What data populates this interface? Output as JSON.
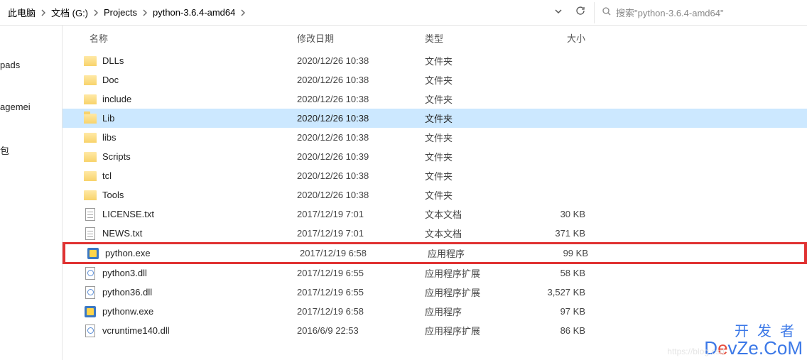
{
  "breadcrumb": [
    "此电脑",
    "文档 (G:)",
    "Projects",
    "python-3.6.4-amd64"
  ],
  "search": {
    "placeholder": "搜索\"python-3.6.4-amd64\""
  },
  "sidebar": {
    "items": [
      "pads",
      "agemei",
      "包"
    ]
  },
  "columns": {
    "name": "名称",
    "date": "修改日期",
    "type": "类型",
    "size": "大小"
  },
  "files": [
    {
      "name": "DLLs",
      "date": "2020/12/26 10:38",
      "type": "文件夹",
      "size": "",
      "icon": "folder"
    },
    {
      "name": "Doc",
      "date": "2020/12/26 10:38",
      "type": "文件夹",
      "size": "",
      "icon": "folder"
    },
    {
      "name": "include",
      "date": "2020/12/26 10:38",
      "type": "文件夹",
      "size": "",
      "icon": "folder"
    },
    {
      "name": "Lib",
      "date": "2020/12/26 10:38",
      "type": "文件夹",
      "size": "",
      "icon": "folder-open",
      "selected": true
    },
    {
      "name": "libs",
      "date": "2020/12/26 10:38",
      "type": "文件夹",
      "size": "",
      "icon": "folder"
    },
    {
      "name": "Scripts",
      "date": "2020/12/26 10:39",
      "type": "文件夹",
      "size": "",
      "icon": "folder"
    },
    {
      "name": "tcl",
      "date": "2020/12/26 10:38",
      "type": "文件夹",
      "size": "",
      "icon": "folder"
    },
    {
      "name": "Tools",
      "date": "2020/12/26 10:38",
      "type": "文件夹",
      "size": "",
      "icon": "folder"
    },
    {
      "name": "LICENSE.txt",
      "date": "2017/12/19 7:01",
      "type": "文本文档",
      "size": "30 KB",
      "icon": "txt"
    },
    {
      "name": "NEWS.txt",
      "date": "2017/12/19 7:01",
      "type": "文本文档",
      "size": "371 KB",
      "icon": "txt"
    },
    {
      "name": "python.exe",
      "date": "2017/12/19 6:58",
      "type": "应用程序",
      "size": "99 KB",
      "icon": "exe",
      "highlighted": true
    },
    {
      "name": "python3.dll",
      "date": "2017/12/19 6:55",
      "type": "应用程序扩展",
      "size": "58 KB",
      "icon": "dll"
    },
    {
      "name": "python36.dll",
      "date": "2017/12/19 6:55",
      "type": "应用程序扩展",
      "size": "3,527 KB",
      "icon": "dll"
    },
    {
      "name": "pythonw.exe",
      "date": "2017/12/19 6:58",
      "type": "应用程序",
      "size": "97 KB",
      "icon": "exe"
    },
    {
      "name": "vcruntime140.dll",
      "date": "2016/6/9 22:53",
      "type": "应用程序扩展",
      "size": "86 KB",
      "icon": "dll"
    }
  ],
  "watermark": {
    "cn": "开发者",
    "en_pre": "D",
    "en_red": "e",
    "en_post": "vZe.CoM",
    "url": "https://blog.csd"
  }
}
